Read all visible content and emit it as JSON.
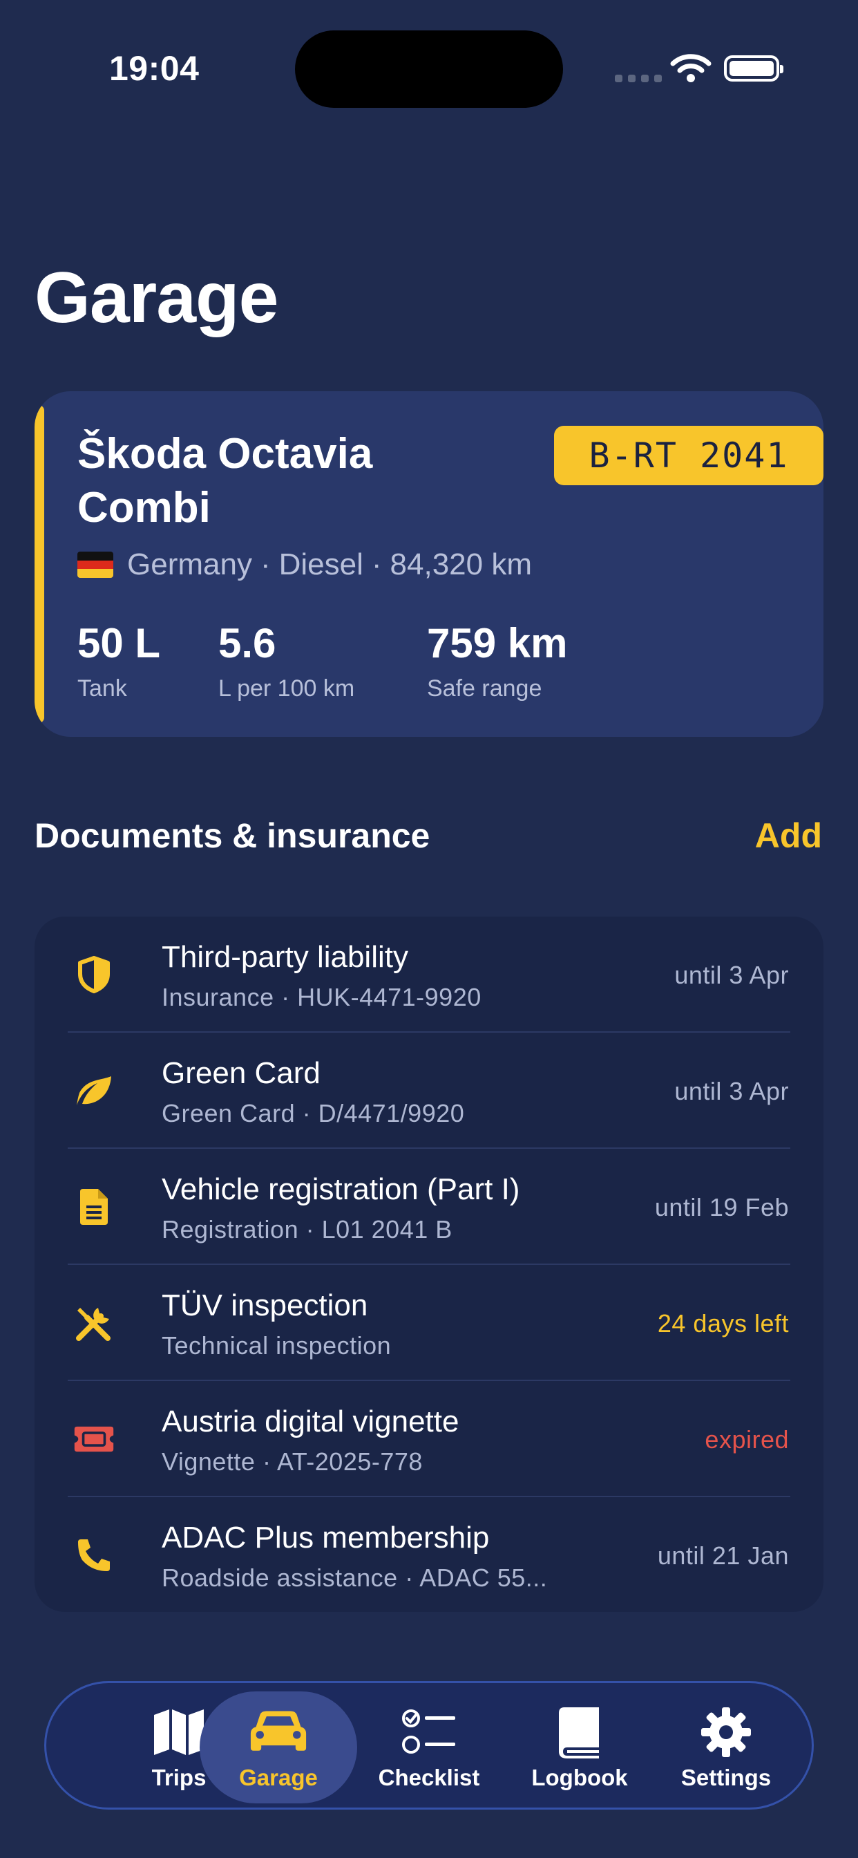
{
  "status_bar": {
    "time": "19:04"
  },
  "page_title": "Garage",
  "vehicle": {
    "name": "Škoda Octavia Combi",
    "plate": "B-RT 2041",
    "country": "Germany",
    "fuel": "Diesel",
    "odometer": "84,320 km",
    "meta_sep": "·",
    "stats": [
      {
        "value": "50 L",
        "label": "Tank"
      },
      {
        "value": "5.6",
        "label": "L per 100 km"
      },
      {
        "value": "759 km",
        "label": "Safe range"
      }
    ],
    "accent_color": "#f8c52b"
  },
  "documents": {
    "title": "Documents & insurance",
    "add_label": "Add",
    "items": [
      {
        "icon": "shield-icon",
        "title": "Third-party liability",
        "subtitle": "Insurance · HUK-4471-9920",
        "status": "until 3 Apr",
        "status_color": "#aeb7d2"
      },
      {
        "icon": "leaf-icon",
        "title": "Green Card",
        "subtitle": "Green Card · D/4471/9920",
        "status": "until 3 Apr",
        "status_color": "#aeb7d2"
      },
      {
        "icon": "document-icon",
        "title": "Vehicle registration (Part I)",
        "subtitle": "Registration · L01 2041 B",
        "status": "until 19 Feb",
        "status_color": "#aeb7d2"
      },
      {
        "icon": "tools-icon",
        "title": "TÜV inspection",
        "subtitle": "Technical inspection",
        "status": "24 days left",
        "status_color": "#f8c52b"
      },
      {
        "icon": "ticket-icon",
        "title": "Austria digital vignette",
        "subtitle": "Vignette · AT-2025-778",
        "status": "expired",
        "status_color": "#e5534b"
      },
      {
        "icon": "phone-icon",
        "title": "ADAC Plus membership",
        "subtitle": "Roadside assistance · ADAC 55...",
        "status": "until 21 Jan",
        "status_color": "#aeb7d2"
      }
    ]
  },
  "tab_bar": {
    "tabs": [
      {
        "label": "Trips",
        "icon": "map-icon"
      },
      {
        "label": "Garage",
        "icon": "car-icon",
        "active": true
      },
      {
        "label": "Checklist",
        "icon": "checklist-icon"
      },
      {
        "label": "Logbook",
        "icon": "book-icon"
      },
      {
        "label": "Settings",
        "icon": "gear-icon"
      }
    ]
  }
}
